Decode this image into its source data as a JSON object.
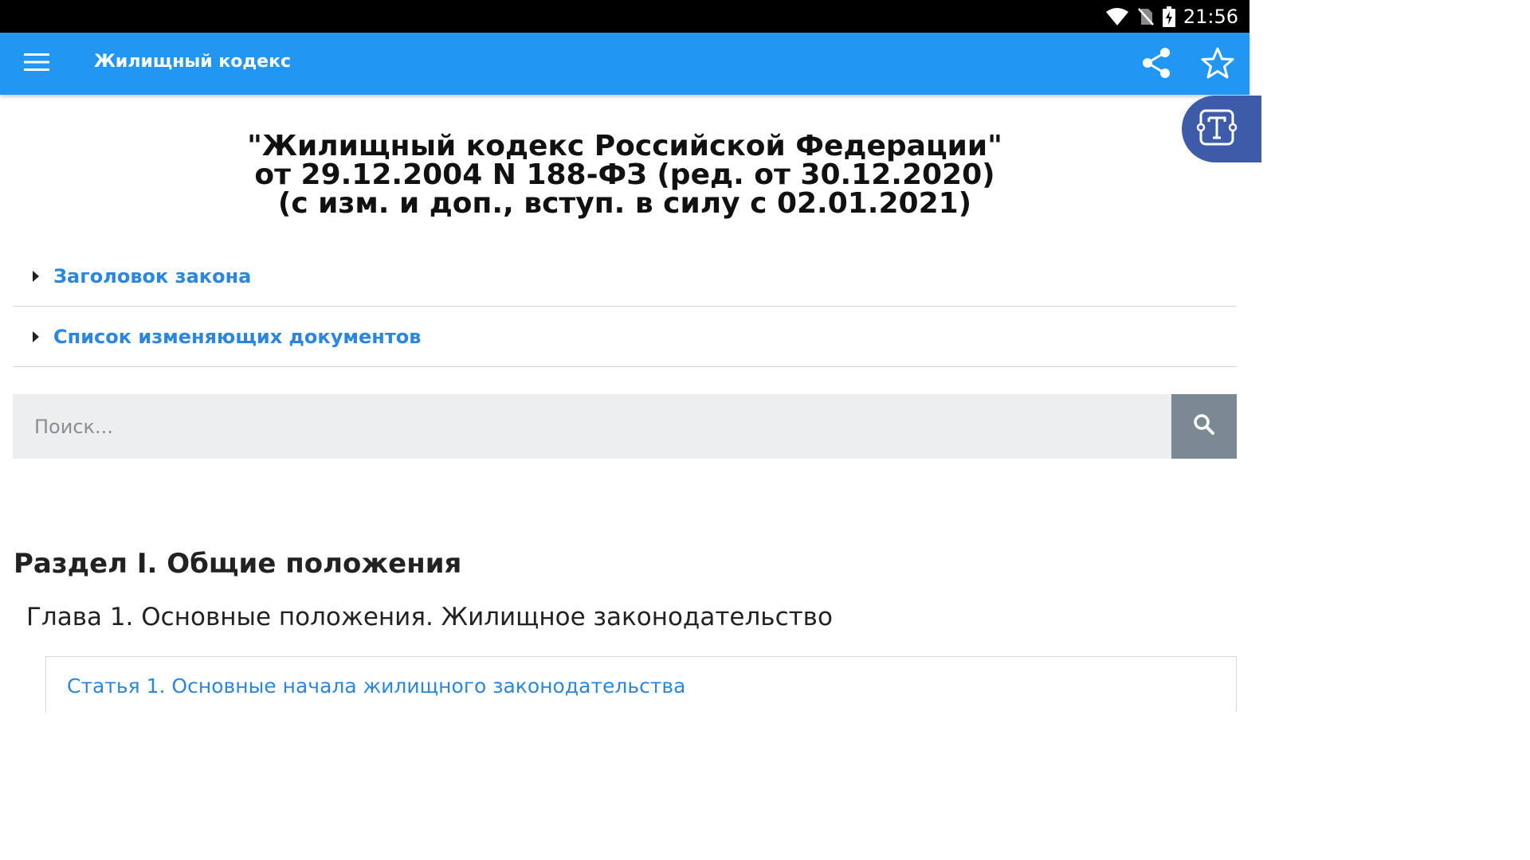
{
  "status_bar": {
    "time": "21:56",
    "icons": [
      "wifi-icon",
      "no-sim-icon",
      "battery-charging-icon"
    ]
  },
  "app_bar": {
    "title": "Жилищный кодекс",
    "icons": [
      "menu-icon",
      "share-icon",
      "star-icon"
    ]
  },
  "fab": {
    "icon": "font-size-icon"
  },
  "document": {
    "title_lines": [
      "\"Жилищный кодекс Российской Федерации\"",
      "от 29.12.2004 N 188-ФЗ (ред. от 30.12.2020)",
      "(с изм. и доп., вступ. в силу с 02.01.2021)"
    ]
  },
  "collapsibles": [
    {
      "label": "Заголовок закона"
    },
    {
      "label": "Список изменяющих документов"
    }
  ],
  "search": {
    "placeholder": "Поиск...",
    "value": ""
  },
  "content": {
    "section": "Раздел I. Общие положения",
    "chapter": "Глава 1. Основные положения. Жилищное законодательство",
    "articles": [
      {
        "label": "Статья 1. Основные начала жилищного законодательства"
      }
    ]
  },
  "colors": {
    "app_bar": "#2196f3",
    "accent_link": "#2a86e0",
    "fab": "#3d5ba9",
    "search_button": "#7b8a92"
  }
}
